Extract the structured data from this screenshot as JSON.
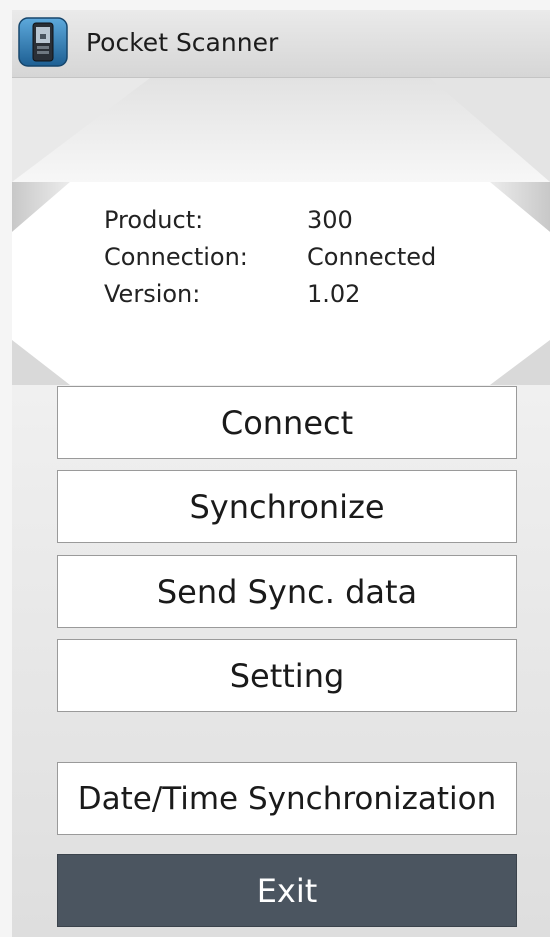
{
  "app": {
    "title": "Pocket Scanner",
    "icon": "scanner-device-icon"
  },
  "info": {
    "rows": [
      {
        "label": "Product:",
        "value": "300"
      },
      {
        "label": "Connection:",
        "value": "Connected"
      },
      {
        "label": "Version:",
        "value": "1.02"
      }
    ]
  },
  "buttons": {
    "connect": "Connect",
    "synchronize": "Synchronize",
    "send_sync_data": "Send Sync. data",
    "setting": "Setting",
    "date_time_sync": "Date/Time Synchronization",
    "exit": "Exit"
  },
  "colors": {
    "exit_button_bg": "#4b5560",
    "button_bg": "#ffffff",
    "title_bar_bg": "#dcdcdc"
  }
}
